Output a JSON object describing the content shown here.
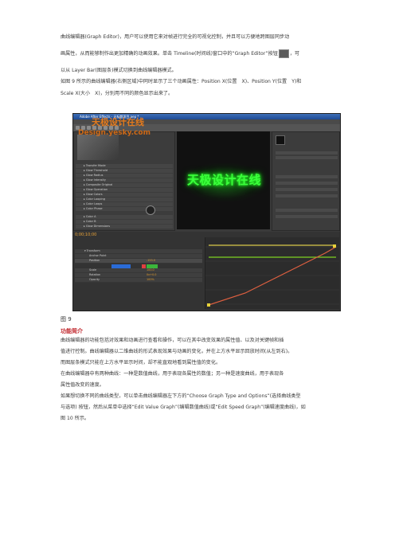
{
  "intro": {
    "line1": "曲线编辑器(Graph Editor)，用户可以使用它来对帧进行完全的可视化控制，并且可以方便地跨图层同步动",
    "line2a": "画属性，从而能够制作出更加精确的动画效果。单击 Timeline(时间线)窗口中的“Graph Editor”按钮",
    "line2b": "，可",
    "line3": "以从 Layer Bar(图层条)模式切换到曲线编辑器模式。",
    "line4": "如图 9 所示的曲线编辑器(右侧区域)中同时显示了三个动画属性：Position X(位置　X)、Position Y(位置　Y)和",
    "line5": "Scale X(大小　X)，分别用不同的颜色显示出来了。"
  },
  "screenshot": {
    "window_title": "Adobe After Effects - 无标题项目.aep *",
    "menu": [
      "File",
      "Edit",
      "Composition",
      "Layer",
      "Effect",
      "Animation",
      "View",
      "Window",
      "Help"
    ],
    "comp_text": "天极设计在线",
    "watermark_top": "天极设计在线",
    "watermark_url": "Design.yesky.com",
    "timecode": "0;00;10;00",
    "timeline_layers": [
      "Position",
      "Scale",
      "Rotation",
      "Opacity"
    ],
    "timeline_values": [
      "-153.0",
      "100.0",
      "0x+0.0",
      "100%"
    ]
  },
  "caption": "图 9",
  "heading": "功能简介",
  "body": [
    "曲线编辑器的功能包括对效果和动画进行查看和操作，可以在其中改变效果的属性值、以及对关键帧和插",
    "值进行控制。曲线编辑器以二维曲线的形式表现效果与动画的变化，并在上方水平显示回放时间(从左到右)。",
    "而图层条模式只能在上方水平显示时间，却不能直观地看到属性值的变化。",
    "在曲线编辑器中有两种曲线：一种是数值曲线，用于表现各属性的数值；另一种是速度曲线，用于表现各",
    "属性值改变的速度。",
    "如果想切换不同的曲线类型，可以单击曲线编辑器左下方的“Choose Graph Type and Options”(选择曲线类型",
    "与选项) 按钮，然后从菜单中选择“Edit Value Graph”(编辑数值曲线)或“Edit Speed Graph”(编辑速度曲线)，如",
    "图 10 所示。"
  ],
  "colors": {
    "heading": "#c0272d",
    "curve_red": "#e04040",
    "curve_green": "#7ed321",
    "curve_yellow": "#e8d23a",
    "glow": "#3bff3b"
  }
}
